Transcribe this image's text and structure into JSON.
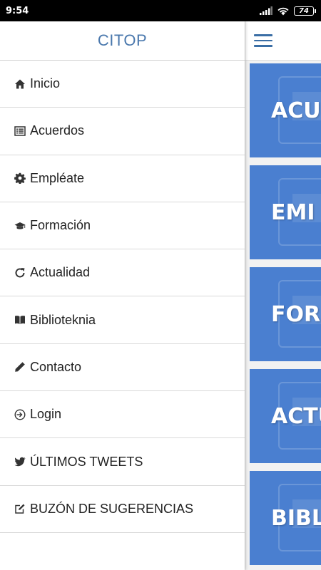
{
  "status_bar": {
    "time": "9:54",
    "battery": "74"
  },
  "drawer": {
    "title": "CITOP",
    "items": [
      {
        "label": "Inicio",
        "icon": "home-icon"
      },
      {
        "label": "Acuerdos",
        "icon": "list-icon"
      },
      {
        "label": "Empléate",
        "icon": "gear-icon"
      },
      {
        "label": "Formación",
        "icon": "graduation-cap-icon"
      },
      {
        "label": "Actualidad",
        "icon": "refresh-icon"
      },
      {
        "label": "Biblioteknia",
        "icon": "book-icon"
      },
      {
        "label": "Contacto",
        "icon": "pencil-icon"
      },
      {
        "label": "Login",
        "icon": "login-icon"
      },
      {
        "label": "ÚLTIMOS TWEETS",
        "icon": "twitter-icon"
      },
      {
        "label": "BUZÓN DE SUGERENCIAS",
        "icon": "edit-icon"
      }
    ]
  },
  "main": {
    "tiles": [
      {
        "label": "ACU"
      },
      {
        "label": "EMI"
      },
      {
        "label": "FORI"
      },
      {
        "label": "ACTU"
      },
      {
        "label": "BIBLI"
      }
    ]
  },
  "colors": {
    "accent": "#4a78ad",
    "tile": "#4a7fd0",
    "status_bar": "#000000"
  }
}
